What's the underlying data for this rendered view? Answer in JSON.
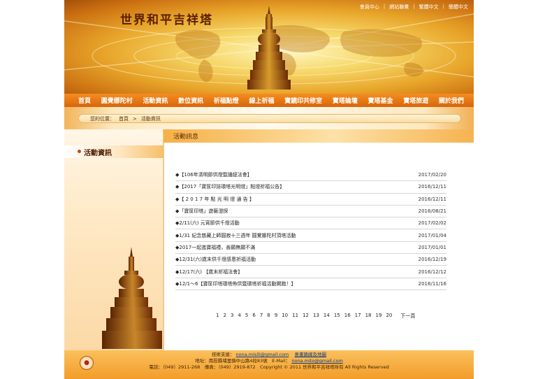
{
  "header": {
    "site_title": "世界和平吉祥塔",
    "top_links": [
      "會員中心",
      "網站聯覺",
      "繁體中文",
      "簡體中文"
    ]
  },
  "nav": {
    "items": [
      "首頁",
      "圓覺娜陀村",
      "活動資訊",
      "數位資訊",
      "祈福點燈",
      "線上祈福",
      "寶鏡印共修室",
      "寶塔論壇",
      "寶塔基金",
      "寶塔旅遊",
      "關於我們"
    ]
  },
  "breadcrumb": {
    "label": "您的位置：",
    "home": "首頁",
    "sep": ">",
    "current": "活動資訊"
  },
  "sidebar": {
    "title": "活動資訊"
  },
  "content": {
    "title": "活動訊息",
    "news": [
      {
        "title": "◆【106年清明節供燈暨誦經法會】",
        "date": "2017/02/20"
      },
      {
        "title": "◆【2017「寶筐印誌環塔光明燈」點燈祈福公告】",
        "date": "2016/12/11"
      },
      {
        "title": "◆【 2 0 1 7 年 點 光 明 燈 通 告 】",
        "date": "2016/12/11"
      },
      {
        "title": "◆「寶筐印塔」遊藝澄探",
        "date": "2016/08/21"
      },
      {
        "title": "◆2/11(六) 元宵節供千燈活動",
        "date": "2017/02/02"
      },
      {
        "title": "◆1/31 紀念慈藏上師圓寂十三週年 圓覺娜陀村頂塔活動",
        "date": "2017/01/04"
      },
      {
        "title": "◆2017一起進寶福禮，善願無願不滿",
        "date": "2017/01/01"
      },
      {
        "title": "◆12/31(六)歲末供千燈感恩祈福活動",
        "date": "2016/12/19"
      },
      {
        "title": "◆12/17(六) 【歲末祈福法會】",
        "date": "2016/12/12"
      },
      {
        "title": "◆12/1～6【寶筐印塔環塔佈供暨環塔祈福活動開跑！】",
        "date": "2016/11/16"
      }
    ],
    "pager": {
      "pages": [
        "1",
        "2",
        "3",
        "4",
        "5",
        "6",
        "7",
        "8",
        "9",
        "10",
        "11",
        "12",
        "13",
        "14",
        "15",
        "16",
        "17",
        "18",
        "19",
        "20"
      ],
      "next": "下一頁"
    }
  },
  "footer": {
    "line1_label": "技術支援：",
    "line1_email": "nona.misili@gmail.com",
    "line1_map": "意畫路線及地圖",
    "line2": "地址：南投縣埔里鎮中山路4段83號　E-Mail：",
    "line2_email": "nona.mito@gmail.com",
    "line3": "電話：（049）2911-268　傳真：（049）2919-872　Copyright © 2011 世界和平吉祥塔所有 All Rights Reserved"
  },
  "colors": {
    "nav_orange": "#e8760f",
    "banner_gold": "#f6d86a",
    "accent_red": "#d93b0b"
  }
}
